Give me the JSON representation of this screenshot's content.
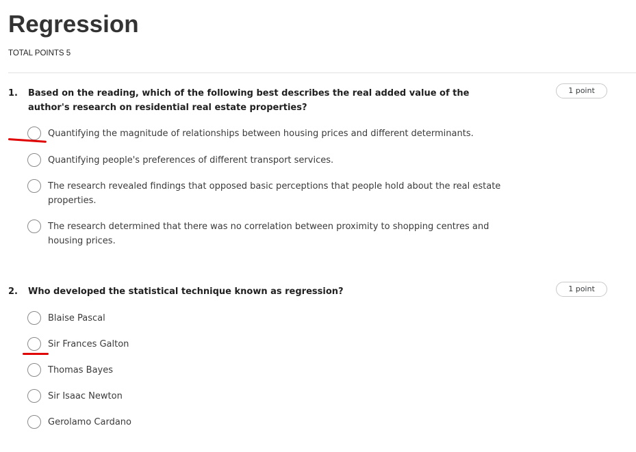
{
  "header": {
    "title": "Regression",
    "total_points": "TOTAL POINTS 5"
  },
  "questions": [
    {
      "number": "1.",
      "text": "Based on the reading, which of the following best describes the real added value of the author's research on residential real estate properties?",
      "points": "1 point",
      "options": [
        "Quantifying the magnitude of relationships between housing prices and different determinants.",
        "Quantifying people's preferences of different transport services.",
        "The research revealed findings that opposed basic perceptions that people hold about the real estate properties.",
        "The research determined that there was no correlation between proximity to shopping centres and housing prices."
      ]
    },
    {
      "number": "2.",
      "text": "Who developed the statistical technique known as regression?",
      "points": "1 point",
      "options": [
        "Blaise Pascal",
        "Sir Frances Galton",
        "Thomas Bayes",
        "Sir Isaac Newton",
        "Gerolamo Cardano"
      ]
    }
  ],
  "colors": {
    "annotation": "#e00000",
    "radio_border": "#8a8a8a",
    "divider": "#e1e1e1"
  }
}
